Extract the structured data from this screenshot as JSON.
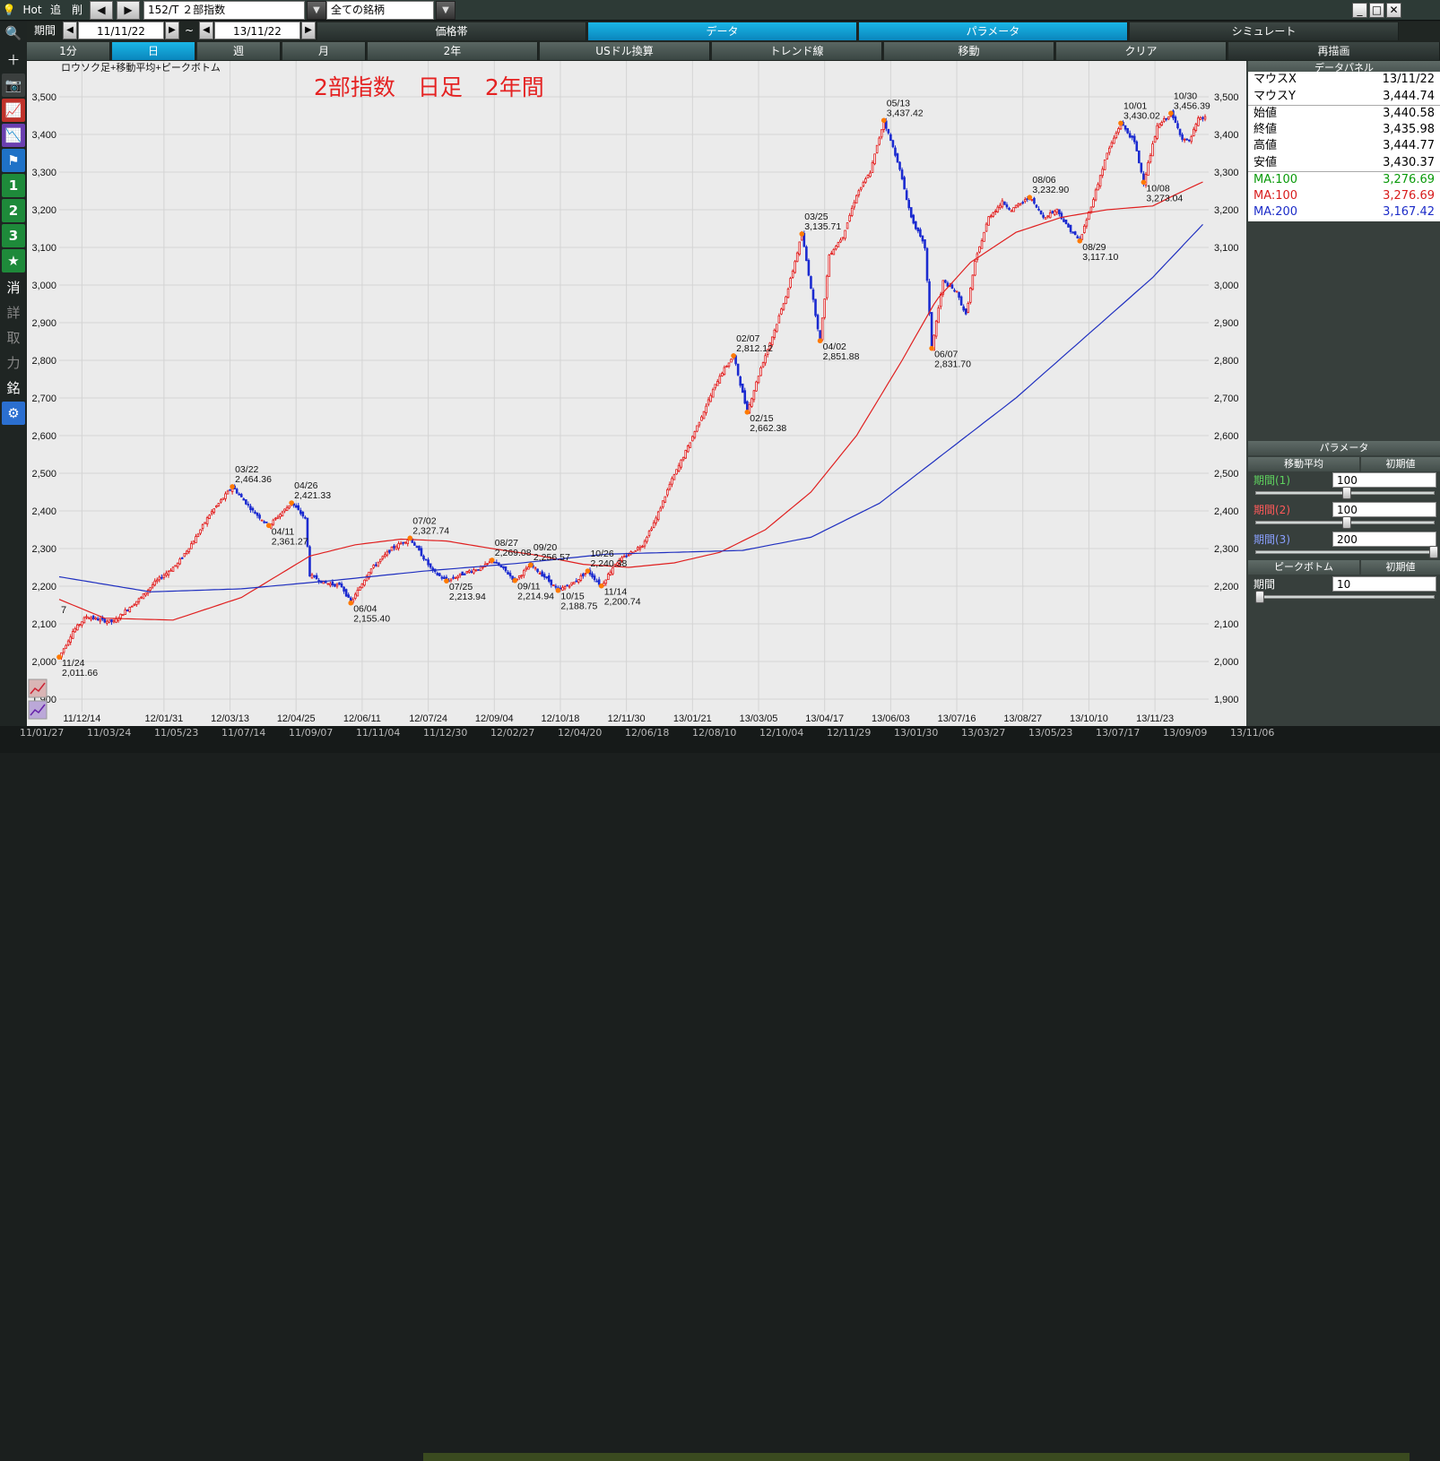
{
  "toolbar": {
    "hot": "Hot",
    "add": "追",
    "del": "削",
    "code": "152/T ２部指数",
    "universe": "全ての銘柄"
  },
  "period": {
    "label": "期間",
    "from": "11/11/22",
    "tilde": "~",
    "to": "13/11/22"
  },
  "top_tabs": [
    "価格帯",
    "データ",
    "パラメータ",
    "シミュレート"
  ],
  "range_tabs": [
    "1分",
    "日",
    "週",
    "月",
    "2年"
  ],
  "func_tabs": [
    "USドル換算",
    "トレンド線",
    "移動",
    "クリア",
    "再描画"
  ],
  "left_tools": [
    "search-icon",
    "crosshair-icon",
    "camera-icon",
    "chart-candle-icon",
    "chart-line-icon",
    "flag-icon",
    "1",
    "2",
    "3",
    "★",
    "消",
    "詳",
    "取",
    "力",
    "銘",
    "gear-icon"
  ],
  "chart_data": {
    "type": "line",
    "title": "2部指数　日足　2年間",
    "subtitle": "ロウソク足+移動平均+ピークボトム",
    "ylim": [
      1870,
      3580
    ],
    "yticks": [
      1900,
      2000,
      2100,
      2200,
      2300,
      2400,
      2500,
      2600,
      2700,
      2800,
      2900,
      3000,
      3100,
      3200,
      3300,
      3400,
      3500
    ],
    "ytick_labels": [
      "1,900",
      "2,000",
      "2,100",
      "2,200",
      "2,300",
      "2,400",
      "2,500",
      "2,600",
      "2,700",
      "2,800",
      "2,900",
      "3,000",
      "3,100",
      "3,200",
      "3,300",
      "3,400",
      "3,500"
    ],
    "xticks": [
      {
        "i": 10,
        "label": "11/12/14"
      },
      {
        "i": 46,
        "label": "12/01/31"
      },
      {
        "i": 75,
        "label": "12/03/13"
      },
      {
        "i": 104,
        "label": "12/04/25"
      },
      {
        "i": 133,
        "label": "12/06/11"
      },
      {
        "i": 162,
        "label": "12/07/24"
      },
      {
        "i": 191,
        "label": "12/09/04"
      },
      {
        "i": 220,
        "label": "12/10/18"
      },
      {
        "i": 249,
        "label": "12/11/30"
      },
      {
        "i": 278,
        "label": "13/01/21"
      },
      {
        "i": 307,
        "label": "13/03/05"
      },
      {
        "i": 336,
        "label": "13/04/17"
      },
      {
        "i": 365,
        "label": "13/06/03"
      },
      {
        "i": 394,
        "label": "13/07/16"
      },
      {
        "i": 423,
        "label": "13/08/27"
      },
      {
        "i": 452,
        "label": "13/10/10"
      },
      {
        "i": 481,
        "label": "13/11/23"
      }
    ],
    "n_days": 490,
    "price_anchors": [
      [
        0,
        2011.66
      ],
      [
        6,
        2080
      ],
      [
        12,
        2120
      ],
      [
        18,
        2110
      ],
      [
        24,
        2105
      ],
      [
        30,
        2140
      ],
      [
        36,
        2170
      ],
      [
        42,
        2210
      ],
      [
        52,
        2260
      ],
      [
        60,
        2330
      ],
      [
        66,
        2390
      ],
      [
        76,
        2464.36
      ],
      [
        85,
        2400
      ],
      [
        92,
        2361.27
      ],
      [
        102,
        2421.33
      ],
      [
        108,
        2380
      ],
      [
        110,
        2230
      ],
      [
        116,
        2210
      ],
      [
        124,
        2200
      ],
      [
        128,
        2155.4
      ],
      [
        136,
        2240
      ],
      [
        146,
        2300
      ],
      [
        154,
        2327.74
      ],
      [
        164,
        2240
      ],
      [
        170,
        2213.94
      ],
      [
        180,
        2240
      ],
      [
        186,
        2250
      ],
      [
        190,
        2269.08
      ],
      [
        196,
        2240
      ],
      [
        200,
        2214.94
      ],
      [
        207,
        2256.57
      ],
      [
        214,
        2220
      ],
      [
        219,
        2188.75
      ],
      [
        226,
        2210
      ],
      [
        232,
        2240.38
      ],
      [
        238,
        2200.74
      ],
      [
        244,
        2260
      ],
      [
        250,
        2285
      ],
      [
        256,
        2310
      ],
      [
        262,
        2380
      ],
      [
        268,
        2470
      ],
      [
        276,
        2570
      ],
      [
        284,
        2680
      ],
      [
        290,
        2760
      ],
      [
        296,
        2812.12
      ],
      [
        302,
        2662.38
      ],
      [
        308,
        2780
      ],
      [
        314,
        2880
      ],
      [
        320,
        2990
      ],
      [
        326,
        3135.71
      ],
      [
        334,
        2851.88
      ],
      [
        338,
        3080
      ],
      [
        344,
        3130
      ],
      [
        350,
        3240
      ],
      [
        356,
        3300
      ],
      [
        362,
        3437.42
      ],
      [
        368,
        3330
      ],
      [
        374,
        3180
      ],
      [
        380,
        3100
      ],
      [
        383,
        2831.7
      ],
      [
        388,
        3010
      ],
      [
        394,
        2980
      ],
      [
        398,
        2920
      ],
      [
        402,
        3060
      ],
      [
        408,
        3180
      ],
      [
        414,
        3220
      ],
      [
        418,
        3200
      ],
      [
        426,
        3232.9
      ],
      [
        432,
        3180
      ],
      [
        438,
        3200
      ],
      [
        442,
        3160
      ],
      [
        448,
        3117.1
      ],
      [
        454,
        3230
      ],
      [
        460,
        3350
      ],
      [
        466,
        3430.02
      ],
      [
        472,
        3380
      ],
      [
        476,
        3273.04
      ],
      [
        482,
        3420
      ],
      [
        488,
        3456.39
      ],
      [
        493,
        3390
      ],
      [
        496,
        3380
      ],
      [
        500,
        3440
      ],
      [
        503,
        3444.77
      ]
    ],
    "series": [
      {
        "name": "MA:100",
        "color": "#e02020",
        "anchors": [
          [
            0,
            2165
          ],
          [
            20,
            2115
          ],
          [
            50,
            2110
          ],
          [
            80,
            2170
          ],
          [
            110,
            2280
          ],
          [
            130,
            2310
          ],
          [
            150,
            2325
          ],
          [
            170,
            2320
          ],
          [
            190,
            2300
          ],
          [
            210,
            2282
          ],
          [
            230,
            2258
          ],
          [
            250,
            2250
          ],
          [
            270,
            2262
          ],
          [
            290,
            2290
          ],
          [
            310,
            2350
          ],
          [
            330,
            2450
          ],
          [
            350,
            2600
          ],
          [
            370,
            2800
          ],
          [
            385,
            2960
          ],
          [
            400,
            3060
          ],
          [
            420,
            3140
          ],
          [
            440,
            3180
          ],
          [
            460,
            3200
          ],
          [
            480,
            3210
          ],
          [
            490,
            3240
          ],
          [
            503,
            3276.69
          ]
        ]
      },
      {
        "name": "MA:200",
        "color": "#2030c0",
        "anchors": [
          [
            0,
            2225
          ],
          [
            40,
            2185
          ],
          [
            80,
            2193
          ],
          [
            120,
            2215
          ],
          [
            160,
            2240
          ],
          [
            200,
            2260
          ],
          [
            240,
            2285
          ],
          [
            270,
            2290
          ],
          [
            300,
            2295
          ],
          [
            330,
            2330
          ],
          [
            360,
            2420
          ],
          [
            390,
            2560
          ],
          [
            420,
            2700
          ],
          [
            450,
            2860
          ],
          [
            480,
            3020
          ],
          [
            503,
            3167.42
          ]
        ]
      }
    ],
    "peaks": [
      {
        "i": 0,
        "date": "11/24",
        "value": "2,011.66",
        "v": 2011.66,
        "pos": "below"
      },
      {
        "i": 76,
        "date": "03/22",
        "value": "2,464.36",
        "v": 2464.36,
        "pos": "above"
      },
      {
        "i": 92,
        "date": "04/11",
        "value": "2,361.27",
        "v": 2361.27,
        "pos": "below"
      },
      {
        "i": 102,
        "date": "04/26",
        "value": "2,421.33",
        "v": 2421.33,
        "pos": "above"
      },
      {
        "i": 128,
        "date": "06/04",
        "value": "2,155.40",
        "v": 2155.4,
        "pos": "below"
      },
      {
        "i": 154,
        "date": "07/02",
        "value": "2,327.74",
        "v": 2327.74,
        "pos": "above"
      },
      {
        "i": 170,
        "date": "07/25",
        "value": "2,213.94",
        "v": 2213.94,
        "pos": "below"
      },
      {
        "i": 190,
        "date": "08/27",
        "value": "2,269.08",
        "v": 2269.08,
        "pos": "above"
      },
      {
        "i": 200,
        "date": "09/11",
        "value": "2,214.94",
        "v": 2214.94,
        "pos": "below"
      },
      {
        "i": 207,
        "date": "09/20",
        "value": "2,256.57",
        "v": 2256.57,
        "pos": "above"
      },
      {
        "i": 219,
        "date": "10/15",
        "value": "2,188.75",
        "v": 2188.75,
        "pos": "below"
      },
      {
        "i": 232,
        "date": "10/26",
        "value": "2,240.38",
        "v": 2240.38,
        "pos": "above"
      },
      {
        "i": 238,
        "date": "11/14",
        "value": "2,200.74",
        "v": 2200.74,
        "pos": "below"
      },
      {
        "i": 296,
        "date": "02/07",
        "value": "2,812.12",
        "v": 2812.12,
        "pos": "above"
      },
      {
        "i": 302,
        "date": "02/15",
        "value": "2,662.38",
        "v": 2662.38,
        "pos": "below"
      },
      {
        "i": 326,
        "date": "03/25",
        "value": "3,135.71",
        "v": 3135.71,
        "pos": "above"
      },
      {
        "i": 334,
        "date": "04/02",
        "value": "2,851.88",
        "v": 2851.88,
        "pos": "below"
      },
      {
        "i": 362,
        "date": "05/13",
        "value": "3,437.42",
        "v": 3437.42,
        "pos": "above"
      },
      {
        "i": 383,
        "date": "06/07",
        "value": "2,831.70",
        "v": 2831.7,
        "pos": "below"
      },
      {
        "i": 426,
        "date": "08/06",
        "value": "3,232.90",
        "v": 3232.9,
        "pos": "above"
      },
      {
        "i": 448,
        "date": "08/29",
        "value": "3,117.10",
        "v": 3117.1,
        "pos": "below"
      },
      {
        "i": 466,
        "date": "10/01",
        "value": "3,430.02",
        "v": 3430.02,
        "pos": "above"
      },
      {
        "i": 476,
        "date": "10/08",
        "value": "3,273.04",
        "v": 3273.04,
        "pos": "below"
      },
      {
        "i": 488,
        "date": "10/30",
        "value": "3,456.39",
        "v": 3456.39,
        "pos": "above"
      }
    ],
    "left_marker": "7",
    "grid": true
  },
  "data_panel": {
    "title": "データパネル",
    "rows": [
      {
        "label": "マウスX",
        "value": "13/11/22",
        "color": "#000000"
      },
      {
        "label": "マウスY",
        "value": "3,444.74",
        "color": "#000000"
      },
      {
        "label": "始値",
        "value": "3,440.58",
        "color": "#000000",
        "sep": true
      },
      {
        "label": "終値",
        "value": "3,435.98",
        "color": "#000000"
      },
      {
        "label": "高値",
        "value": "3,444.77",
        "color": "#000000"
      },
      {
        "label": "安値",
        "value": "3,430.37",
        "color": "#000000"
      },
      {
        "label": "MA:100",
        "value": "3,276.69",
        "color": "#0a9a0a",
        "sep": true
      },
      {
        "label": "MA:100",
        "value": "3,276.69",
        "color": "#d81c1c"
      },
      {
        "label": "MA:200",
        "value": "3,167.42",
        "color": "#1c2cc8"
      }
    ]
  },
  "params": {
    "title": "パラメータ",
    "ma_label": "移動平均",
    "init": "初期値",
    "p1": {
      "label": "期間(1)",
      "value": "100",
      "color": "#5fd35f",
      "level": 0.5
    },
    "p2": {
      "label": "期間(2)",
      "value": "100",
      "color": "#ff5a5a",
      "level": 0.5
    },
    "p3": {
      "label": "期間(3)",
      "value": "200",
      "color": "#8aa0ff",
      "level": 1.0
    },
    "pb_title": "ピークボトム",
    "pb_label": "期間",
    "pb_value": "10",
    "pb_level": 0.0
  },
  "bottom_dates": [
    "11/01/27",
    "11/03/24",
    "11/05/23",
    "11/07/14",
    "11/09/07",
    "11/11/04",
    "11/12/30",
    "12/02/27",
    "12/04/20",
    "12/06/18",
    "12/08/10",
    "12/10/04",
    "12/11/29",
    "13/01/30",
    "13/03/27",
    "13/05/23",
    "13/07/17",
    "13/09/09",
    "13/11/06"
  ]
}
